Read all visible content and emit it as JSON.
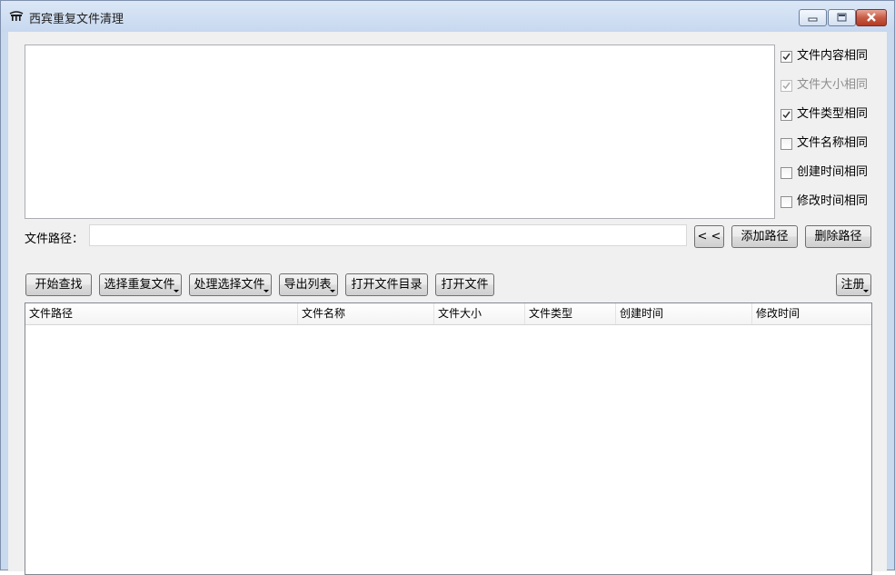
{
  "window": {
    "title": "西宾重复文件清理",
    "icon": "app-icon",
    "controls": [
      "minimize-icon",
      "maximize-icon",
      "close-icon"
    ]
  },
  "options": [
    {
      "label": "文件内容相同",
      "checked": true,
      "enabled": true
    },
    {
      "label": "文件大小相同",
      "checked": true,
      "enabled": false
    },
    {
      "label": "文件类型相同",
      "checked": true,
      "enabled": true
    },
    {
      "label": "文件名称相同",
      "checked": false,
      "enabled": true
    },
    {
      "label": "创建时间相同",
      "checked": false,
      "enabled": true
    },
    {
      "label": "修改时间相同",
      "checked": false,
      "enabled": true
    }
  ],
  "path": {
    "label": "文件路径：",
    "value": "",
    "placeholder": "",
    "back_label": "< <",
    "add_label": "添加路径",
    "remove_label": "删除路径"
  },
  "toolbar": {
    "start_search": "开始查找",
    "select_duplicates": "选择重复文件",
    "process_selected": "处理选择文件",
    "export_list": "导出列表",
    "open_folder": "打开文件目录",
    "open_file": "打开文件",
    "register": "注册"
  },
  "table": {
    "columns": [
      "文件路径",
      "文件名称",
      "文件大小",
      "文件类型",
      "创建时间",
      "修改时间"
    ],
    "rows": []
  }
}
